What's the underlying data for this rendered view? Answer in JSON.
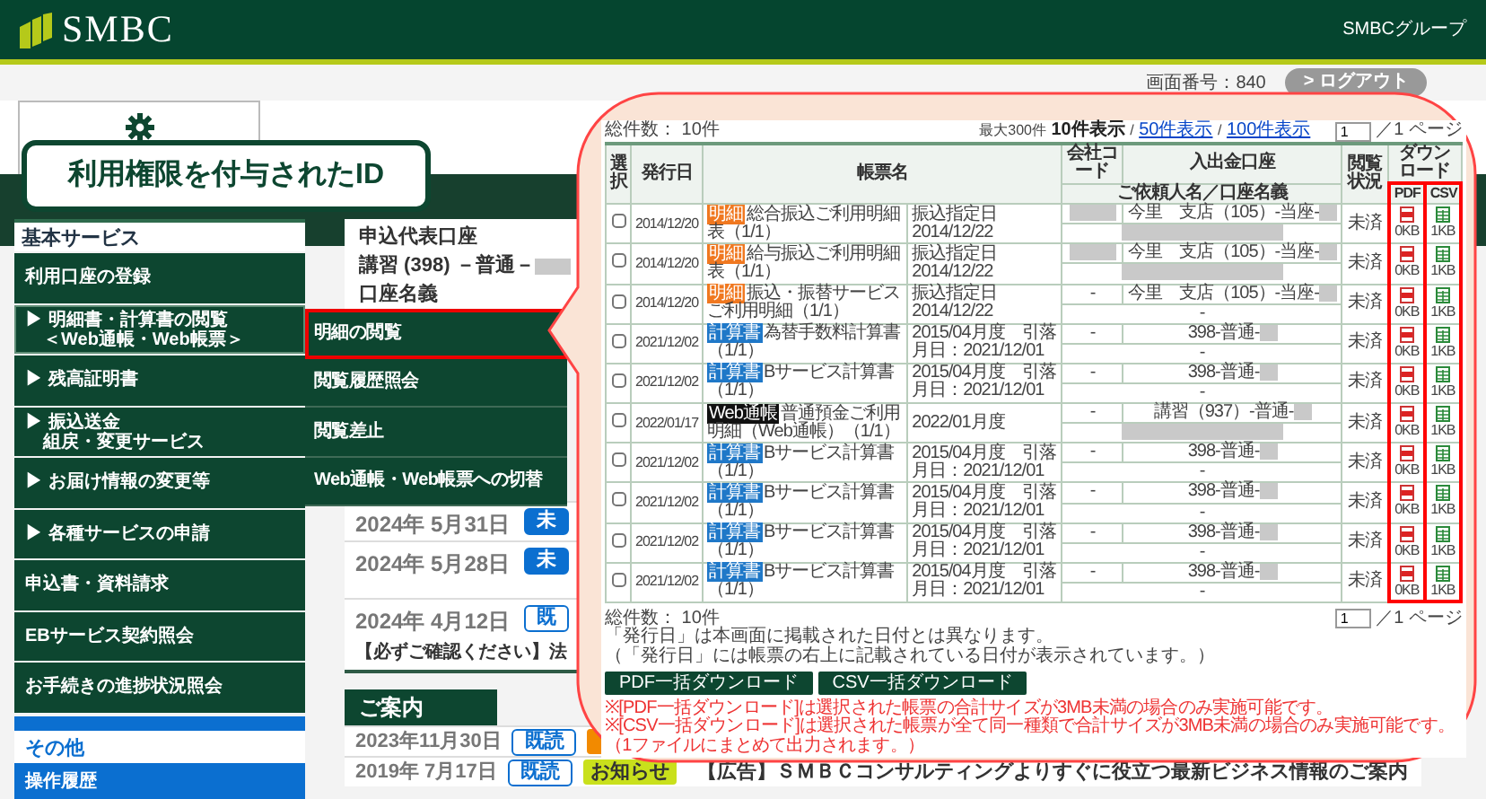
{
  "header": {
    "logo": "SMBC",
    "group_label": "SMBCグループ"
  },
  "subbar": {
    "screen_number": "画面番号：840",
    "logout": "> ログアウト"
  },
  "callout_label": "利用権限を付与されたID",
  "sidebar": {
    "section": "基本サービス",
    "items": [
      {
        "label": "利用口座の登録",
        "selected": false
      },
      {
        "marker": "▶",
        "label": "明細書・計算書の閲覧",
        "sub": "＜Web通帳・Web帳票＞",
        "selected": true
      },
      {
        "marker": "▶",
        "label": "残高証明書",
        "selected": false
      },
      {
        "marker": "▶",
        "label": "振込送金",
        "sub": "組戻・変更サービス",
        "selected": false
      },
      {
        "marker": "▶",
        "label": "お届け情報の変更等",
        "selected": false
      },
      {
        "marker": "▶",
        "label": "各種サービスの申請",
        "selected": false
      },
      {
        "label": "申込書・資料請求",
        "selected": false
      },
      {
        "label": "EBサービス契約照会",
        "selected": false
      },
      {
        "label": "お手続きの進捗状況照会",
        "selected": false
      }
    ],
    "other_section": "その他",
    "other_items": [
      {
        "label": "操作履歴"
      }
    ]
  },
  "submenu": [
    {
      "label": "明細の閲覧",
      "highlighted": true
    },
    {
      "label": "閲覧履歴照会",
      "highlighted": false
    },
    {
      "label": "閲覧差止",
      "highlighted": false
    },
    {
      "label": "Web通帳・Web帳票への切替",
      "highlighted": false
    }
  ],
  "account_panel": {
    "title": "申込代表口座",
    "account": "講習 (398) －普通－",
    "account_masked": true,
    "name_label": "口座名義"
  },
  "notices": [
    {
      "date": "2024年 5月31日",
      "badge": "未",
      "read": false
    },
    {
      "date": "2024年 5月28日",
      "badge": "未",
      "read": false
    },
    {
      "date": "2024年 4月12日",
      "badge": "既",
      "read": true,
      "title": "【必ずご確認ください】法"
    }
  ],
  "guide": {
    "title": "ご案内",
    "items": [
      {
        "date": "2023年11月30日",
        "badge": "既読",
        "read": true,
        "color": "#f28a00"
      },
      {
        "date": "2019年 7月17日",
        "badge": "既読",
        "read": true,
        "tag": "お知らせ",
        "color": "#c9e01c",
        "title": "【広告】ＳＭＢＣコンサルティングよりすぐに役立つ最新ビジネス情報のご案内"
      }
    ]
  },
  "statements": {
    "total": "総件数： 10件",
    "max": "最大300件",
    "page_sizes": [
      {
        "label": "10件表示",
        "selected": true
      },
      {
        "label": "50件表示",
        "selected": false
      },
      {
        "label": "100件表示",
        "selected": false
      }
    ],
    "page_size_separator": "/",
    "page_input": "1",
    "page_total": "／1 ページ",
    "columns": {
      "select": "選択",
      "issue_date": "発行日",
      "name": "帳票名",
      "company_code": "会社コード",
      "account": "入出金口座",
      "payer": "ご依頼人名／口座名義",
      "status": "閲覧状況",
      "download": "ダウンロード",
      "pdf": "PDF",
      "csv": "CSV"
    },
    "download_highlighted": true,
    "rows": [
      {
        "selected": false,
        "date": "2014/12/20",
        "badge": "明細",
        "kind": "detail",
        "name": "総合振込ご利用明細表（1/1）",
        "info": "振込指定日2014/12/22",
        "company_masked": true,
        "account": "今里　支店（105）-当座-",
        "account_masked": true,
        "payer_masked": true,
        "status": "未済",
        "pdf_size": "0KB",
        "csv_size": "1KB"
      },
      {
        "selected": false,
        "date": "2014/12/20",
        "badge": "明細",
        "kind": "detail",
        "name": "給与振込ご利用明細表（1/1）",
        "info": "振込指定日2014/12/22",
        "company_masked": true,
        "account": "今里　支店（105）-当座-",
        "account_masked": true,
        "payer_masked": true,
        "status": "未済",
        "pdf_size": "0KB",
        "csv_size": "1KB"
      },
      {
        "selected": false,
        "date": "2014/12/20",
        "badge": "明細",
        "kind": "detail",
        "name": "振込・振替サービスご利用明細（1/1）",
        "info": "振込指定日2014/12/22",
        "company_code": "-",
        "company_masked": false,
        "account": "今里　支店（105）-当座-",
        "account_masked": true,
        "payer": "-",
        "payer_masked": false,
        "status": "未済",
        "pdf_size": "0KB",
        "csv_size": "1KB"
      },
      {
        "selected": false,
        "date": "2021/12/02",
        "badge": "計算書",
        "kind": "statement",
        "name": "為替手数料計算書（1/1）",
        "info": "2015/04月度　引落月日：2021/12/01",
        "company_code": "-",
        "company_masked": false,
        "account": "398-普通-",
        "account_masked": true,
        "payer": "-",
        "payer_masked": false,
        "status": "未済",
        "pdf_size": "0KB",
        "csv_size": "1KB"
      },
      {
        "selected": false,
        "date": "2021/12/02",
        "badge": "計算書",
        "kind": "statement",
        "name": "Bサービス計算書（1/1）",
        "info": "2015/04月度　引落月日：2021/12/01",
        "company_code": "-",
        "company_masked": false,
        "account": "398-普通-",
        "account_masked": true,
        "payer": "-",
        "payer_masked": false,
        "status": "未済",
        "pdf_size": "0KB",
        "csv_size": "1KB"
      },
      {
        "selected": false,
        "date": "2022/01/17",
        "badge": "Web通帳",
        "kind": "passbook",
        "name": "普通預金ご利用明細（Web通帳）（1/1）",
        "info": "2022/01月度",
        "company_code": "-",
        "company_masked": false,
        "account": "講習（937）-普通-",
        "account_masked": true,
        "payer_masked": true,
        "status": "未済",
        "pdf_size": "0KB",
        "csv_size": "1KB"
      },
      {
        "selected": false,
        "date": "2021/12/02",
        "badge": "計算書",
        "kind": "statement",
        "name": "Bサービス計算書（1/1）",
        "info": "2015/04月度　引落月日：2021/12/01",
        "company_code": "-",
        "company_masked": false,
        "account": "398-普通-",
        "account_masked": true,
        "payer": "-",
        "payer_masked": false,
        "status": "未済",
        "pdf_size": "0KB",
        "csv_size": "1KB"
      },
      {
        "selected": false,
        "date": "2021/12/02",
        "badge": "計算書",
        "kind": "statement",
        "name": "Bサービス計算書（1/1）",
        "info": "2015/04月度　引落月日：2021/12/01",
        "company_code": "-",
        "company_masked": false,
        "account": "398-普通-",
        "account_masked": true,
        "payer": "-",
        "payer_masked": false,
        "status": "未済",
        "pdf_size": "0KB",
        "csv_size": "1KB"
      },
      {
        "selected": false,
        "date": "2021/12/02",
        "badge": "計算書",
        "kind": "statement",
        "name": "Bサービス計算書（1/1）",
        "info": "2015/04月度　引落月日：2021/12/01",
        "company_code": "-",
        "company_masked": false,
        "account": "398-普通-",
        "account_masked": true,
        "payer": "-",
        "payer_masked": false,
        "status": "未済",
        "pdf_size": "0KB",
        "csv_size": "1KB"
      },
      {
        "selected": false,
        "date": "2021/12/02",
        "badge": "計算書",
        "kind": "statement",
        "name": "Bサービス計算書（1/1）",
        "info": "2015/04月度　引落月日：2021/12/01",
        "company_code": "-",
        "company_masked": false,
        "account": "398-普通-",
        "account_masked": true,
        "payer": "-",
        "payer_masked": false,
        "status": "未済",
        "pdf_size": "0KB",
        "csv_size": "1KB"
      }
    ],
    "footer_total": "総件数： 10件",
    "footer_page_input": "1",
    "footer_page_total": "／1 ページ",
    "notes": [
      "「発行日」は本画面に掲載された日付とは異なります。",
      "（「発行日」には帳票の右上に記載されている日付が表示されています。）"
    ],
    "buttons": [
      "PDF一括ダウンロード",
      "CSV一括ダウンロード"
    ],
    "warnings": [
      "※[PDF一括ダウンロード]は選択された帳票の合計サイズが3MB未満の場合のみ実施可能です。",
      "※[CSV一括ダウンロード]は選択された帳票が全て同一種類で合計サイズが3MB未満の場合のみ実施可能です。",
      "（1ファイルにまとめて出力されます。）"
    ]
  }
}
